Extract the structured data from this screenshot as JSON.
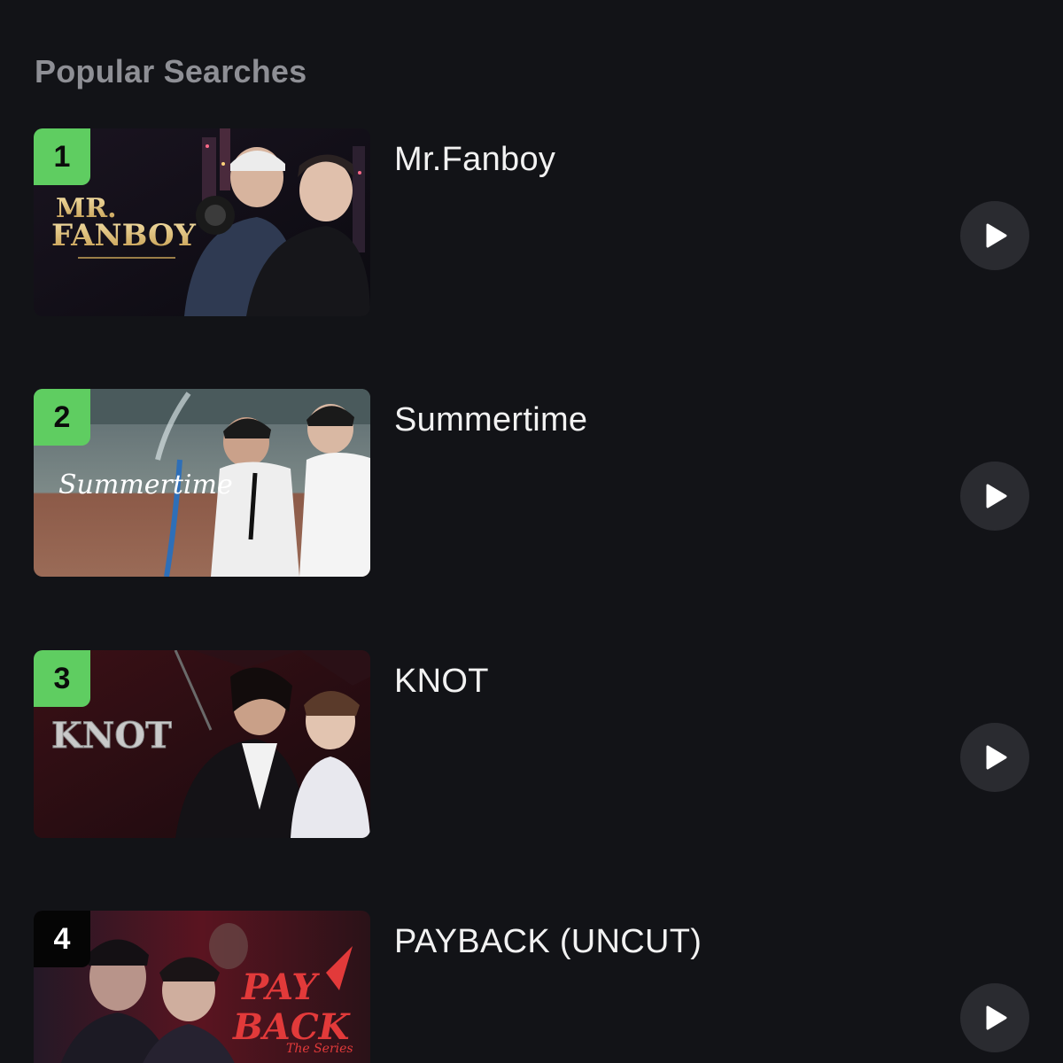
{
  "section": {
    "title": "Popular Searches"
  },
  "results": [
    {
      "rank": "1",
      "title": "Mr.Fanboy",
      "thumbnail_logo": "MR. FANBOY",
      "badge_color": "#5fcd61"
    },
    {
      "rank": "2",
      "title": "Summertime",
      "thumbnail_logo": "Summertime",
      "badge_color": "#5fcd61"
    },
    {
      "rank": "3",
      "title": "KNOT",
      "thumbnail_logo": "KNOT",
      "badge_color": "#5fcd61"
    },
    {
      "rank": "4",
      "title": "PAYBACK (UNCUT)",
      "thumbnail_logo": "PAY BACK The Series",
      "badge_color": "#050505"
    }
  ],
  "icons": {
    "play": "play-icon"
  },
  "colors": {
    "background": "#121317",
    "section_title": "#8e8f95",
    "item_title": "#f2f2f2",
    "play_button_bg": "#2a2b30",
    "top_rank_badge": "#5fcd61"
  }
}
